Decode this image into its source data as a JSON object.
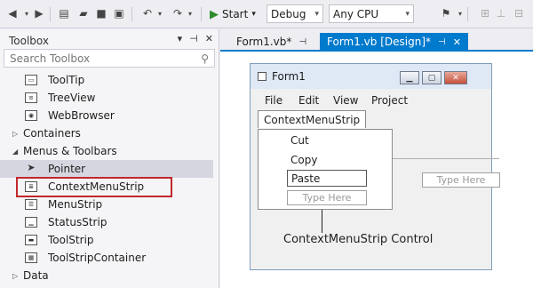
{
  "toolbar": {
    "start_label": "Start",
    "config_value": "Debug",
    "platform_value": "Any CPU"
  },
  "toolbox": {
    "title": "Toolbox",
    "pin_glyph": "▾ ⊣ ✕",
    "search_placeholder": "Search Toolbox",
    "items": [
      {
        "label": "ToolTip",
        "type": "item"
      },
      {
        "label": "TreeView",
        "type": "item"
      },
      {
        "label": "WebBrowser",
        "type": "item"
      },
      {
        "label": "Containers",
        "type": "group"
      },
      {
        "label": "Menus & Toolbars",
        "type": "group-open"
      },
      {
        "label": "Pointer",
        "type": "item"
      },
      {
        "label": "ContextMenuStrip",
        "type": "item"
      },
      {
        "label": "MenuStrip",
        "type": "item"
      },
      {
        "label": "StatusStrip",
        "type": "item"
      },
      {
        "label": "ToolStrip",
        "type": "item"
      },
      {
        "label": "ToolStripContainer",
        "type": "item"
      },
      {
        "label": "Data",
        "type": "group"
      }
    ]
  },
  "tabs": [
    {
      "label": "Form1.vb*",
      "active": false
    },
    {
      "label": "Form1.vb [Design]*",
      "active": true
    }
  ],
  "form": {
    "title": "Form1",
    "menu": [
      "File",
      "Edit",
      "View",
      "Project"
    ],
    "context_menu_label": "ContextMenuStrip",
    "context_items": [
      "Cut",
      "Copy",
      "Paste"
    ],
    "type_here": "Type Here",
    "type_here_side": "Type Here"
  },
  "callout": "ContextMenuStrip Control",
  "colors": {
    "accent": "#007acc",
    "highlight_border": "#c0282d"
  }
}
